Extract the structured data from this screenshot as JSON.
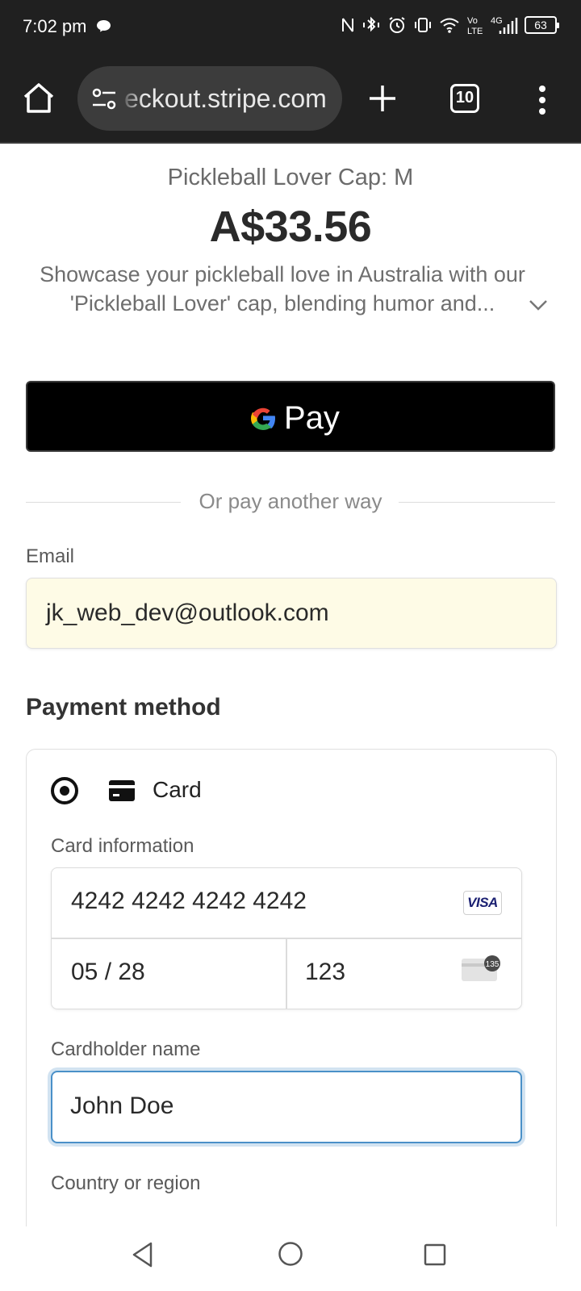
{
  "status_bar": {
    "time": "7:02 pm",
    "battery": "63",
    "network": "4G"
  },
  "browser": {
    "url": "eckout.stripe.com",
    "tab_count": "10"
  },
  "product": {
    "name": "Pickleball Lover Cap: M",
    "price": "A$33.56",
    "description": "Showcase your pickleball love in Australia with our 'Pickleball Lover' cap, blending humor and..."
  },
  "gpay": {
    "label": "Pay"
  },
  "separator": {
    "text": "Or pay another way"
  },
  "email": {
    "label": "Email",
    "value": "jk_web_dev@outlook.com"
  },
  "payment": {
    "section_title": "Payment method",
    "method_label": "Card",
    "card_info_label": "Card information",
    "card_number": "4242 4242 4242 4242",
    "card_brand": "VISA",
    "expiry": "05 / 28",
    "cvc": "123",
    "cvc_icon_text": "135",
    "cardholder_label": "Cardholder name",
    "cardholder_value": "John Doe",
    "country_label": "Country or region"
  },
  "colors": {
    "status_bg": "#202020",
    "focus_ring": "#4a90c8",
    "autofill_bg": "#fefbe6"
  }
}
